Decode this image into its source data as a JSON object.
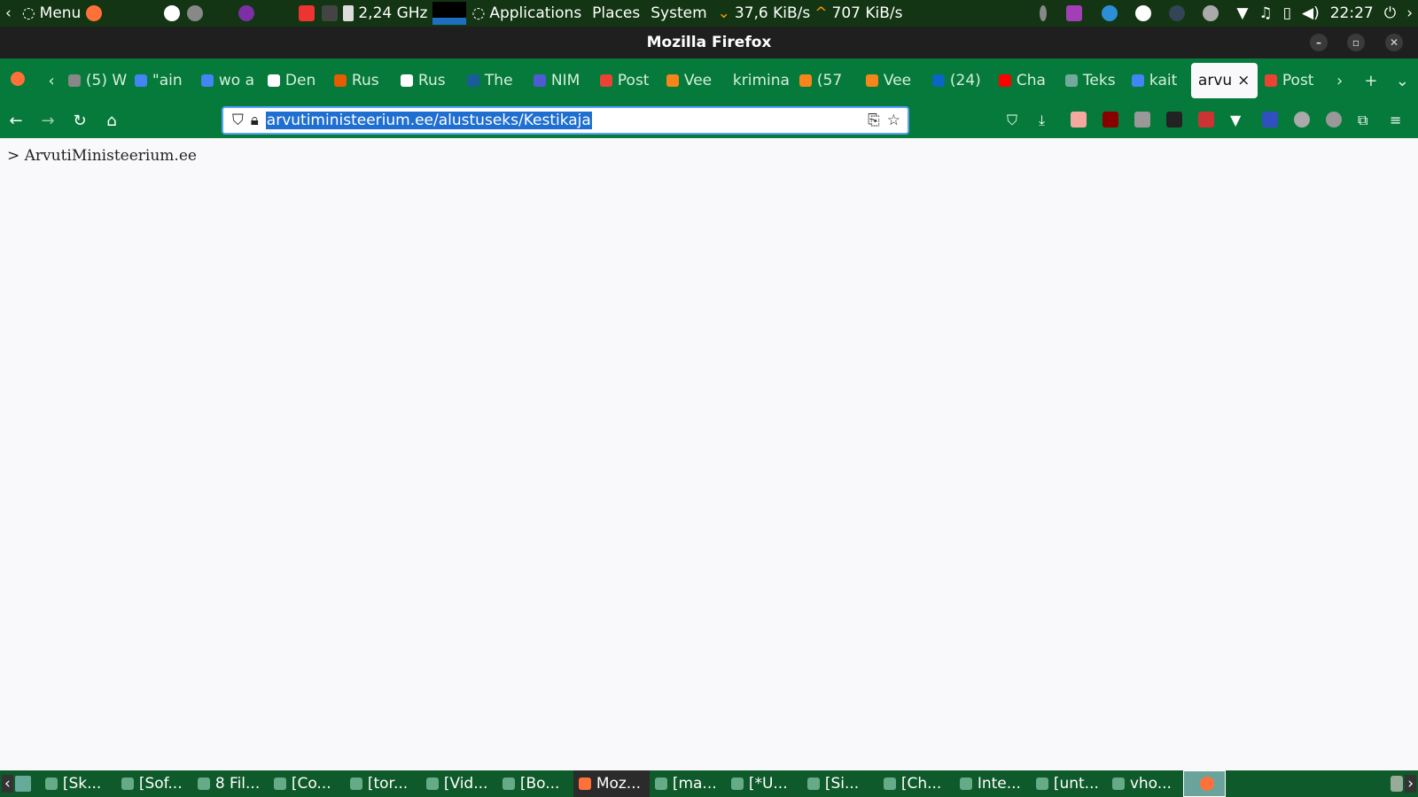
{
  "top_panel": {
    "menu": "Menu",
    "cpu": "2,24 GHz",
    "applications": "Applications",
    "places": "Places",
    "system": "System",
    "net_down": "37,6 KiB/s",
    "net_up": "707 KiB/s",
    "clock": "22:27"
  },
  "window": {
    "title": "Mozilla Firefox"
  },
  "tabs": [
    {
      "label": "(5) W",
      "color": "#888"
    },
    {
      "label": "\"ain",
      "color": "#4285f4"
    },
    {
      "label": "wo a",
      "color": "#4285f4"
    },
    {
      "label": "Den",
      "color": "#fff"
    },
    {
      "label": "Rus",
      "color": "#e65c00"
    },
    {
      "label": "Rus",
      "color": "#fff"
    },
    {
      "label": "The",
      "color": "#1a5c9a"
    },
    {
      "label": "NIM",
      "color": "#4f5bd5"
    },
    {
      "label": "Post",
      "color": "#ea4335"
    },
    {
      "label": "Vee",
      "color": "#f6851b"
    },
    {
      "label": "krimina",
      "color": ""
    },
    {
      "label": "(57",
      "color": "#f6851b"
    },
    {
      "label": "Vee",
      "color": "#f6851b"
    },
    {
      "label": "(24)",
      "color": "#0a66c2"
    },
    {
      "label": "Cha",
      "color": "#ff0000"
    },
    {
      "label": "Teks",
      "color": "#74aa9c"
    },
    {
      "label": "kait",
      "color": "#4285f4"
    },
    {
      "label": "arvu",
      "color": "",
      "active": true
    },
    {
      "label": "Post",
      "color": "#ea4335"
    }
  ],
  "address_bar": {
    "url_selected": "arvutiministeerium.ee/alustuseks/Kestikaja"
  },
  "page": {
    "text": "> ArvutiMinisteerium.ee"
  },
  "taskbar": [
    {
      "label": "[Sk..."
    },
    {
      "label": "[Sof..."
    },
    {
      "label": "8 Fil..."
    },
    {
      "label": "[Co..."
    },
    {
      "label": "[tor..."
    },
    {
      "label": "[Vid..."
    },
    {
      "label": "[Bo..."
    },
    {
      "label": "Moz...",
      "active": true
    },
    {
      "label": "[ma..."
    },
    {
      "label": "[*U..."
    },
    {
      "label": "[Si..."
    },
    {
      "label": "[Ch..."
    },
    {
      "label": "Inte..."
    },
    {
      "label": "[unt..."
    },
    {
      "label": "vho..."
    }
  ]
}
